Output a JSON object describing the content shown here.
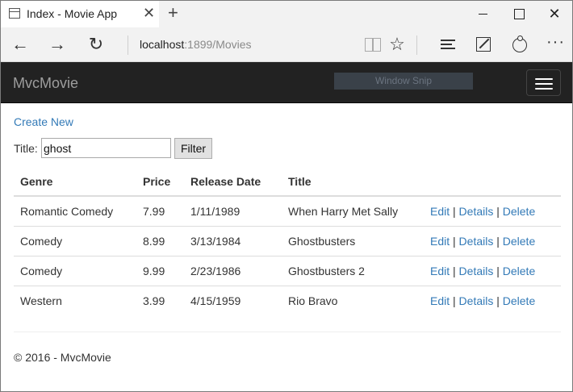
{
  "browser": {
    "tab_title": "Index - Movie App",
    "url_host": "localhost",
    "url_rest": ":1899/Movies"
  },
  "site": {
    "brand": "MvcMovie",
    "overlay_text": "Window Snip"
  },
  "page": {
    "create_link": "Create New",
    "filter_label": "Title:",
    "filter_value": "ghost",
    "filter_button": "Filter"
  },
  "table": {
    "headers": {
      "genre": "Genre",
      "price": "Price",
      "release_date": "Release Date",
      "title": "Title"
    },
    "rows": [
      {
        "genre": "Romantic Comedy",
        "price": "7.99",
        "release_date": "1/11/1989",
        "title": "When Harry Met Sally"
      },
      {
        "genre": "Comedy",
        "price": "8.99",
        "release_date": "3/13/1984",
        "title": "Ghostbusters"
      },
      {
        "genre": "Comedy",
        "price": "9.99",
        "release_date": "2/23/1986",
        "title": "Ghostbusters 2"
      },
      {
        "genre": "Western",
        "price": "3.99",
        "release_date": "4/15/1959",
        "title": "Rio Bravo"
      }
    ],
    "actions": {
      "edit": "Edit",
      "details": "Details",
      "delete": "Delete",
      "separator": "|"
    }
  },
  "footer": {
    "text": "© 2016 - MvcMovie"
  },
  "colors": {
    "link": "#337ab7",
    "header_bg": "#222222",
    "brand_text": "#9d9d9d"
  }
}
